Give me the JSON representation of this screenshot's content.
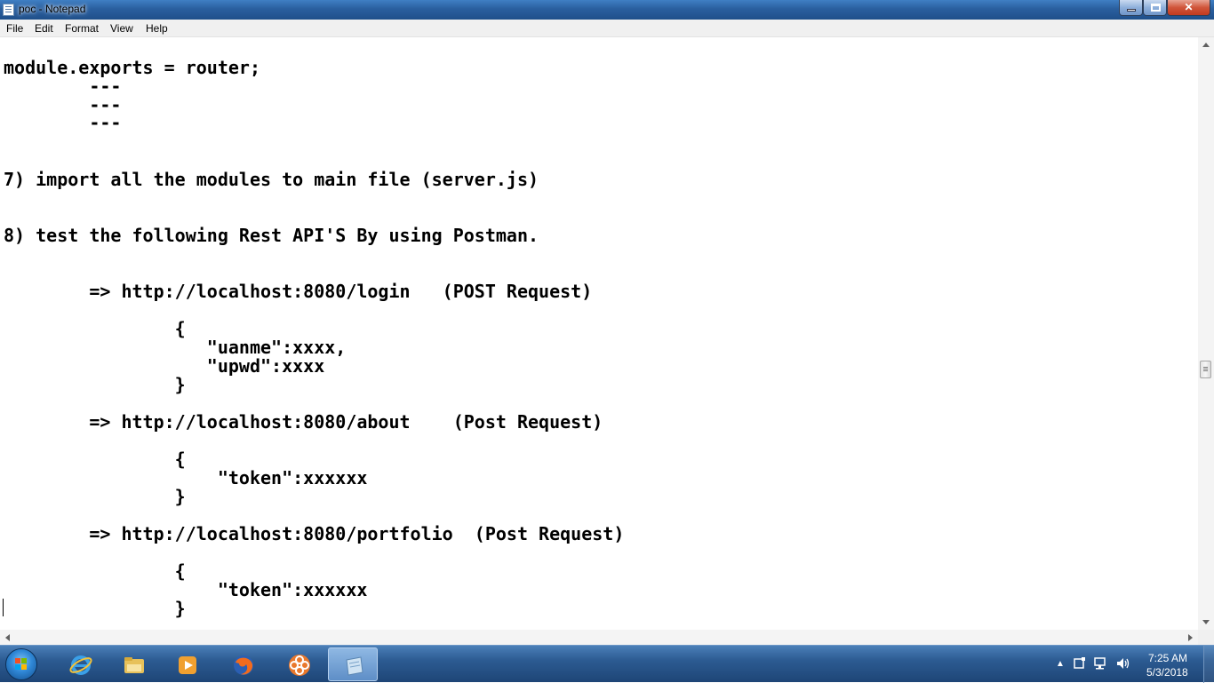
{
  "window": {
    "title": "poc - Notepad"
  },
  "menu": [
    "File",
    "Edit",
    "Format",
    "View",
    "Help"
  ],
  "editor": {
    "lines": [
      "module.exports = router;",
      "        ---",
      "        ---",
      "        ---",
      "7) import all the modules to main file (server.js)",
      "8) test the following Rest API'S By using Postman.",
      "        => http://localhost:8080/login   (POST Request)",
      "                {",
      "                   \"uanme\":xxxx,",
      "                   \"upwd\":xxxx",
      "                }",
      "        => http://localhost:8080/about    (Post Request)",
      "                {",
      "                    \"token\":xxxxxx",
      "                }",
      "        => http://localhost:8080/portfolio  (Post Request)",
      "                {",
      "                    \"token\":xxxxxx",
      "                }"
    ]
  },
  "taskbar": {
    "apps": [
      {
        "name": "internet-explorer-icon"
      },
      {
        "name": "file-explorer-icon"
      },
      {
        "name": "media-player-icon"
      },
      {
        "name": "firefox-icon"
      },
      {
        "name": "flower-app-icon"
      },
      {
        "name": "notepad-icon"
      }
    ],
    "clock": {
      "time": "7:25 AM",
      "date": "5/3/2018"
    }
  },
  "colors": {
    "taskbar": "#2c5b92",
    "titlebar": "#2a5f9f",
    "close": "#c23a1f"
  }
}
